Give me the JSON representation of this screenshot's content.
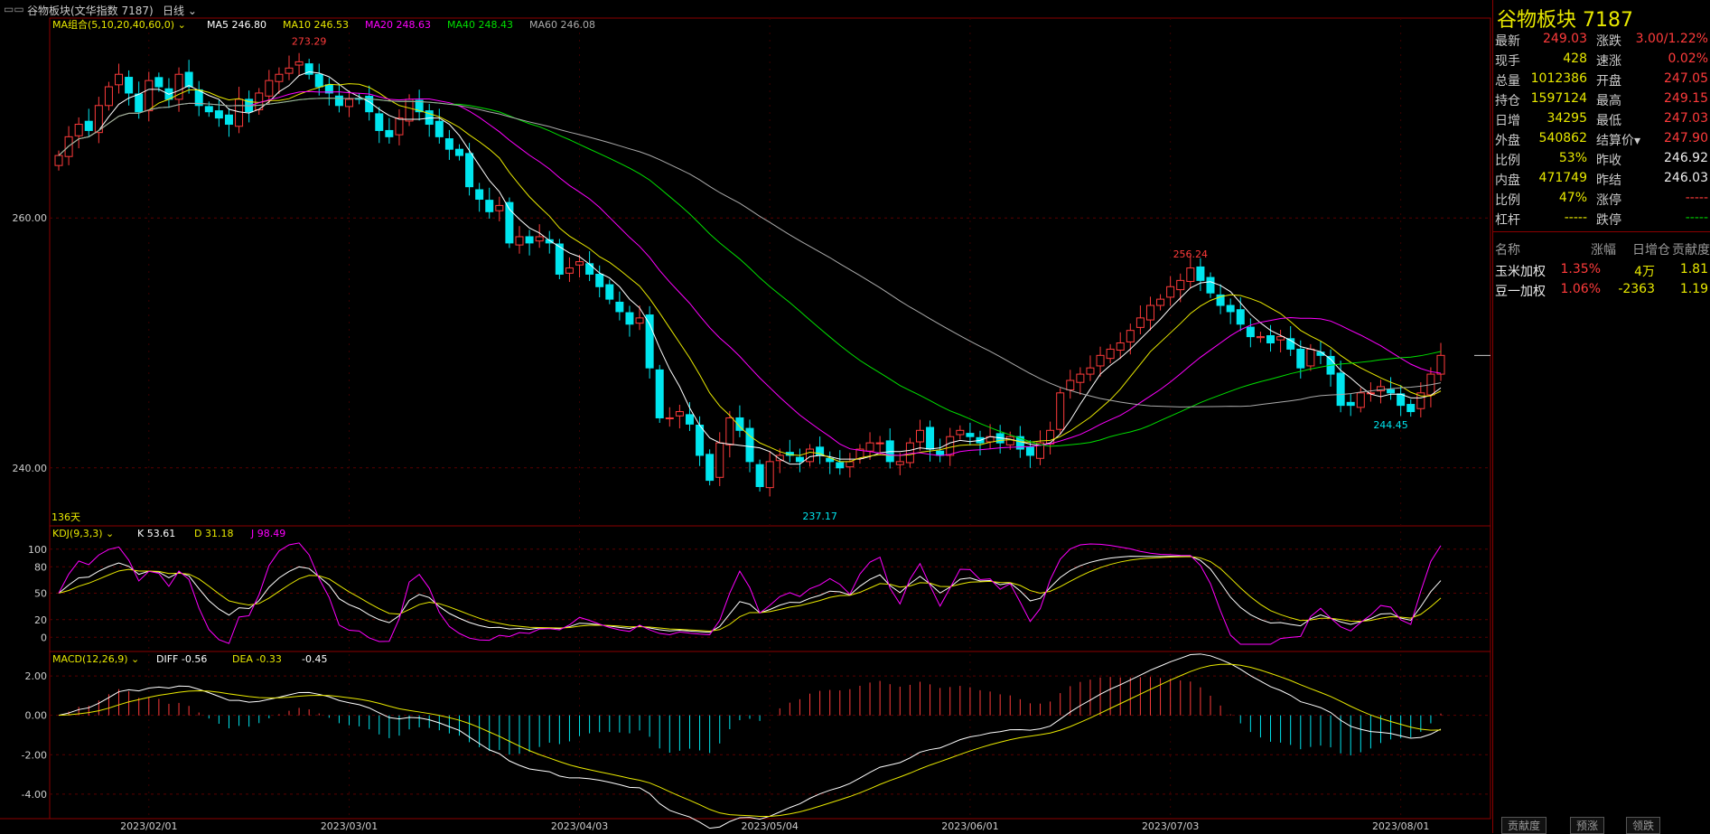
{
  "window": {
    "title": "谷物板块(文华指数 7187)",
    "period": "日线"
  },
  "main_legend": {
    "group": "MA组合(5,10,20,40,60,0)",
    "items": [
      {
        "label": "MA5",
        "value": "246.80",
        "color": "#ffffff"
      },
      {
        "label": "MA10",
        "value": "246.53",
        "color": "#e8e800"
      },
      {
        "label": "MA20",
        "value": "248.63",
        "color": "#ff00ff"
      },
      {
        "label": "MA40",
        "value": "248.43",
        "color": "#00e000"
      },
      {
        "label": "MA60",
        "value": "246.08",
        "color": "#aaaaaa"
      }
    ]
  },
  "kdj_legend": {
    "group": "KDJ(9,3,3)",
    "items": [
      {
        "label": "K",
        "value": "53.61",
        "color": "#ffffff"
      },
      {
        "label": "D",
        "value": "31.18",
        "color": "#e8e800"
      },
      {
        "label": "J",
        "value": "98.49",
        "color": "#ff00ff"
      }
    ]
  },
  "macd_legend": {
    "group": "MACD(12,26,9)",
    "items": [
      {
        "label": "DIFF",
        "value": "-0.56",
        "color": "#ffffff"
      },
      {
        "label": "DEA",
        "value": "-0.33",
        "color": "#e8e800"
      },
      {
        "label": "",
        "value": "-0.45",
        "color": "#ffffff"
      }
    ]
  },
  "day_count": "136天",
  "quote_panel": {
    "title": "谷物板块  7187",
    "rows": [
      {
        "l1": "最新",
        "v1": "249.03",
        "c1": "red",
        "l2": "涨跌",
        "v2": "3.00/1.22%",
        "c2": "red"
      },
      {
        "l1": "现手",
        "v1": "428",
        "c1": "yel",
        "l2": "速涨",
        "v2": "0.02%",
        "c2": "red"
      },
      {
        "l1": "总量",
        "v1": "1012386",
        "c1": "yel",
        "l2": "开盘",
        "v2": "247.05",
        "c2": "red"
      },
      {
        "l1": "持仓",
        "v1": "1597124",
        "c1": "yel",
        "l2": "最高",
        "v2": "249.15",
        "c2": "red"
      },
      {
        "l1": "日增",
        "v1": "34295",
        "c1": "yel",
        "l2": "最低",
        "v2": "247.03",
        "c2": "red"
      },
      {
        "l1": "外盘",
        "v1": "540862",
        "c1": "yel",
        "l2": "结算价▾",
        "v2": "247.90",
        "c2": "red"
      },
      {
        "l1": "比例",
        "v1": "53%",
        "c1": "yel",
        "l2": "昨收",
        "v2": "246.92",
        "c2": "wht"
      },
      {
        "l1": "内盘",
        "v1": "471749",
        "c1": "yel",
        "l2": "昨结",
        "v2": "246.03",
        "c2": "wht"
      },
      {
        "l1": "比例",
        "v1": "47%",
        "c1": "yel",
        "l2": "涨停",
        "v2": "-----",
        "c2": "red"
      },
      {
        "l1": "杠杆",
        "v1": "-----",
        "c1": "yel",
        "l2": "跌停",
        "v2": "-----",
        "c2": "grn"
      }
    ],
    "table_headers": [
      "名称",
      "涨幅",
      "日增仓",
      "贡献度"
    ],
    "table_rows": [
      {
        "name": "玉米加权",
        "change": "1.35%",
        "oi": "4万",
        "contrib": "1.81"
      },
      {
        "name": "豆一加权",
        "change": "1.06%",
        "oi": "-2363",
        "contrib": "1.19"
      }
    ],
    "tabs": [
      "贡献度",
      "预涨",
      "领跌"
    ]
  },
  "chart_data": {
    "type": "candlestick",
    "price_axis": {
      "ylim": [
        235.5,
        276
      ],
      "ticks": [
        "260.00",
        "240.00"
      ],
      "tick_values": [
        260,
        240
      ]
    },
    "kdj_axis": {
      "ylim": [
        -10,
        110
      ],
      "ticks": [
        "100",
        "80",
        "50",
        "20",
        "0"
      ],
      "tick_values": [
        100,
        80,
        50,
        20,
        0
      ]
    },
    "macd_axis": {
      "ylim": [
        -5.2,
        2.6
      ],
      "ticks": [
        "2.00",
        "0.00",
        "-2.00",
        "-4.00"
      ],
      "tick_values": [
        2,
        0,
        -2,
        -4
      ]
    },
    "x_labels": [
      {
        "label": "2023/02/01",
        "index": 9
      },
      {
        "label": "2023/03/01",
        "index": 29
      },
      {
        "label": "2023/04/03",
        "index": 52
      },
      {
        "label": "2023/05/04",
        "index": 71
      },
      {
        "label": "2023/06/01",
        "index": 91
      },
      {
        "label": "2023/07/03",
        "index": 111
      },
      {
        "label": "2023/08/01",
        "index": 134
      }
    ],
    "annotations": [
      {
        "label": "273.29",
        "index": 25,
        "value": 273.29
      },
      {
        "label": "237.17",
        "index": 76,
        "value": 237.17
      },
      {
        "label": "256.24",
        "index": 113,
        "value": 256.24
      },
      {
        "label": "244.45",
        "index": 133,
        "value": 244.45
      }
    ],
    "closes": [
      265.0,
      266.5,
      267.5,
      267.0,
      269.0,
      270.5,
      271.5,
      270.0,
      268.5,
      271.0,
      270.5,
      269.5,
      271.5,
      270.5,
      269.0,
      268.5,
      268.0,
      267.5,
      269.5,
      268.5,
      270.0,
      271.0,
      271.5,
      272.0,
      272.5,
      271.5,
      270.5,
      270.0,
      269.0,
      269.5,
      269.5,
      268.5,
      267.0,
      266.5,
      268.0,
      269.5,
      268.5,
      267.5,
      266.5,
      265.5,
      265.0,
      262.5,
      261.5,
      260.5,
      261.0,
      258.0,
      258.5,
      258.0,
      258.5,
      258.0,
      255.5,
      256.0,
      256.5,
      255.5,
      254.5,
      253.5,
      252.5,
      251.5,
      252.0,
      248.0,
      244.0,
      244.0,
      244.5,
      243.5,
      241.0,
      239.0,
      242.0,
      244.0,
      243.0,
      240.5,
      238.5,
      240.5,
      241.0,
      241.0,
      240.5,
      241.5,
      241.0,
      240.5,
      240.0,
      240.5,
      241.5,
      242.0,
      242.0,
      240.5,
      240.5,
      242.0,
      243.0,
      241.5,
      241.0,
      242.5,
      243.0,
      242.5,
      242.0,
      242.5,
      242.0,
      242.5,
      241.5,
      241.0,
      242.0,
      243.0,
      246.0,
      247.0,
      247.5,
      248.0,
      249.0,
      249.5,
      250.0,
      251.0,
      252.0,
      253.0,
      253.5,
      254.5,
      255.0,
      256.0,
      255.0,
      254.0,
      253.0,
      252.5,
      251.5,
      250.5,
      250.5,
      250.0,
      250.5,
      249.5,
      248.0,
      249.5,
      249.0,
      247.5,
      245.0,
      245.0,
      246.0,
      246.0,
      246.5,
      246.0,
      245.0,
      244.5,
      246.0,
      247.5,
      249.0
    ],
    "series": [
      {
        "name": "MA5",
        "color": "#ffffff"
      },
      {
        "name": "MA10",
        "color": "#e8e800"
      },
      {
        "name": "MA20",
        "color": "#ff00ff"
      },
      {
        "name": "MA40",
        "color": "#00e000"
      },
      {
        "name": "MA60",
        "color": "#aaaaaa"
      }
    ]
  }
}
